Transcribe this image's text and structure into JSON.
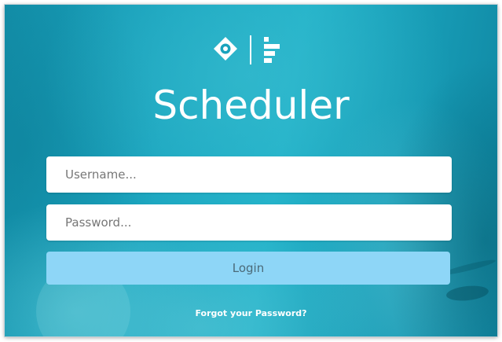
{
  "app": {
    "title": "Scheduler",
    "logo_icons": [
      "diamond-target-icon",
      "gantt-bars-icon"
    ]
  },
  "form": {
    "username_placeholder": "Username...",
    "username_value": "",
    "password_placeholder": "Password...",
    "password_value": "",
    "login_label": "Login",
    "forgot_password_label": "Forgot your Password?"
  },
  "colors": {
    "background": "#1aa9c3",
    "login_button": "#8ed6f7",
    "login_text": "#4b6a78",
    "text_on_bg": "#ffffff"
  }
}
